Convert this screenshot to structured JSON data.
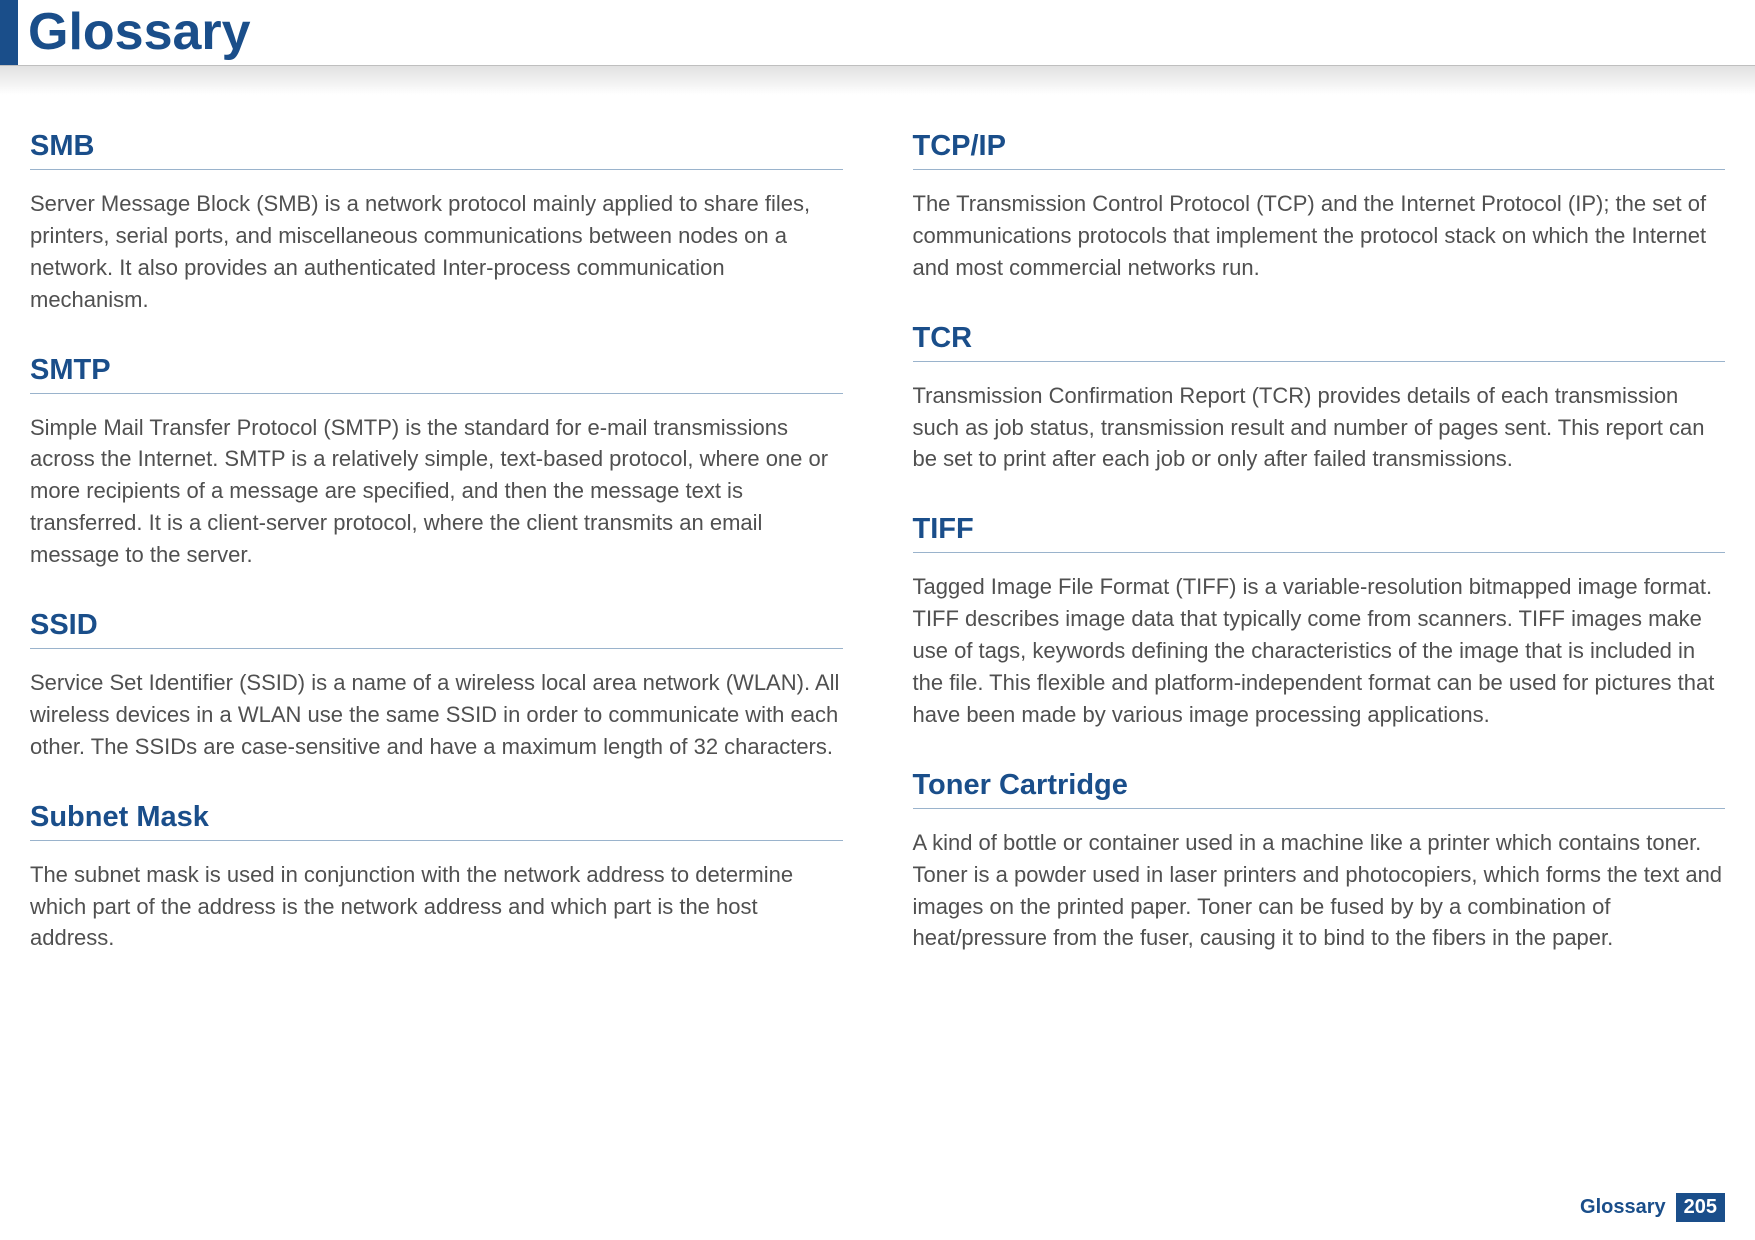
{
  "header": {
    "title": "Glossary"
  },
  "left": {
    "entries": [
      {
        "term": "SMB",
        "definition": "Server Message Block (SMB) is a network protocol mainly applied to share files, printers, serial ports, and miscellaneous communications between nodes on a network. It also provides an authenticated Inter-process communication mechanism."
      },
      {
        "term": "SMTP",
        "definition": "Simple Mail Transfer Protocol (SMTP) is the standard for e-mail transmissions across the Internet. SMTP is a relatively simple, text-based protocol, where one or more recipients of a message are specified, and then the message text is transferred. It is a client-server protocol, where the client transmits an email message to the server."
      },
      {
        "term": "SSID",
        "definition": "Service Set Identifier (SSID) is a name of a wireless local area network (WLAN). All wireless devices in a WLAN use the same SSID in order to communicate with each other. The SSIDs are case-sensitive and have a maximum length of 32 characters."
      },
      {
        "term": "Subnet Mask",
        "definition": "The subnet mask is used in conjunction with the network address to determine which part of the address is the network address and which part is the host address."
      }
    ]
  },
  "right": {
    "entries": [
      {
        "term": "TCP/IP",
        "definition": "The Transmission Control Protocol (TCP) and the Internet Protocol (IP); the set of communications protocols that implement the protocol stack on which the Internet and most commercial networks run."
      },
      {
        "term": "TCR",
        "definition": "Transmission Confirmation Report (TCR) provides details of each transmission such as job status, transmission result and number of pages sent. This report can be set to print after each job or only after failed transmissions."
      },
      {
        "term": "TIFF",
        "definition": "Tagged Image File Format (TIFF) is a variable-resolution bitmapped image format. TIFF describes image data that typically come from scanners. TIFF images make use of tags, keywords defining the characteristics of the image that is included in the file. This flexible and platform-independent format can be used for pictures that have been made by various image processing applications."
      },
      {
        "term": "Toner Cartridge",
        "definition": "A kind of bottle or container used in a machine like a printer which contains toner. Toner is a powder used in laser printers and photocopiers, which forms the text and images on the printed paper. Toner can be fused by by a combination of heat/pressure from the fuser, causing it to bind to the fibers in the paper."
      }
    ]
  },
  "footer": {
    "label": "Glossary",
    "page": "205"
  }
}
